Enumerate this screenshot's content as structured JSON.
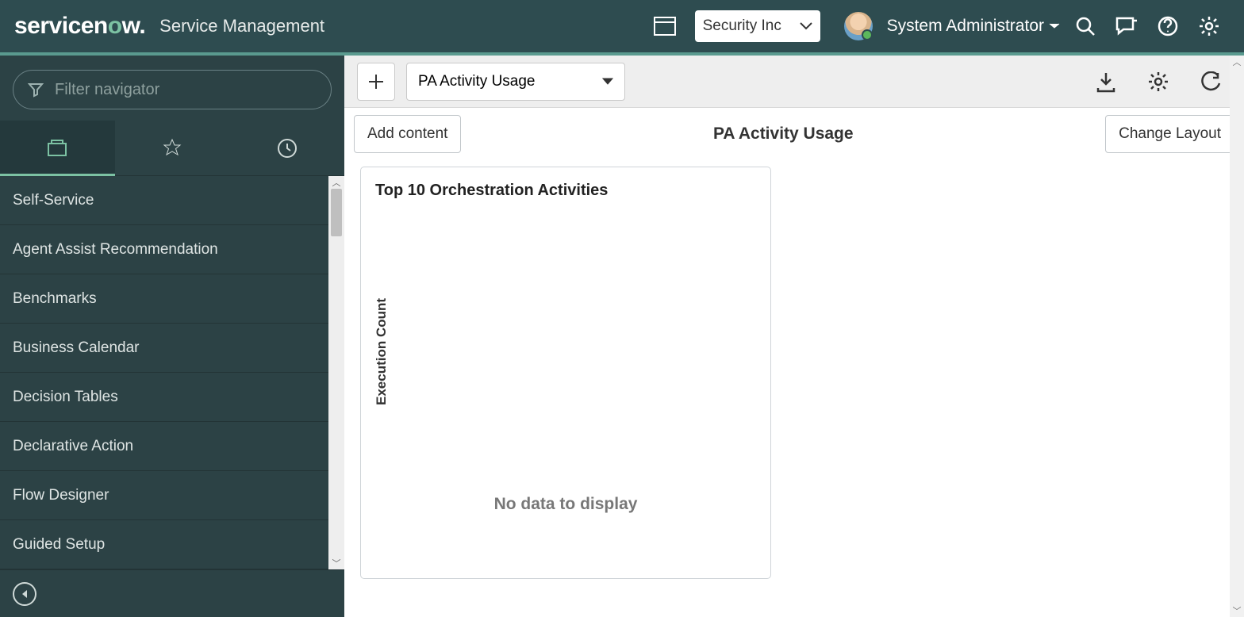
{
  "banner": {
    "app_name": "Service Management",
    "picker_value": "Security Inc",
    "user_name": "System Administrator"
  },
  "navigator": {
    "filter_placeholder": "Filter navigator",
    "items": [
      "Self-Service",
      "Agent Assist Recommendation",
      "Benchmarks",
      "Business Calendar",
      "Decision Tables",
      "Declarative Action",
      "Flow Designer",
      "Guided Setup"
    ]
  },
  "toolbar": {
    "dashboard_select": "PA Activity Usage"
  },
  "page": {
    "add_content": "Add content",
    "title": "PA Activity Usage",
    "change_layout": "Change Layout"
  },
  "widget": {
    "title": "Top 10 Orchestration Activities",
    "y_axis": "Execution Count",
    "empty": "No data to display"
  },
  "chart_data": {
    "type": "bar",
    "title": "Top 10 Orchestration Activities",
    "xlabel": "",
    "ylabel": "Execution Count",
    "categories": [],
    "values": [],
    "note": "No data to display"
  }
}
